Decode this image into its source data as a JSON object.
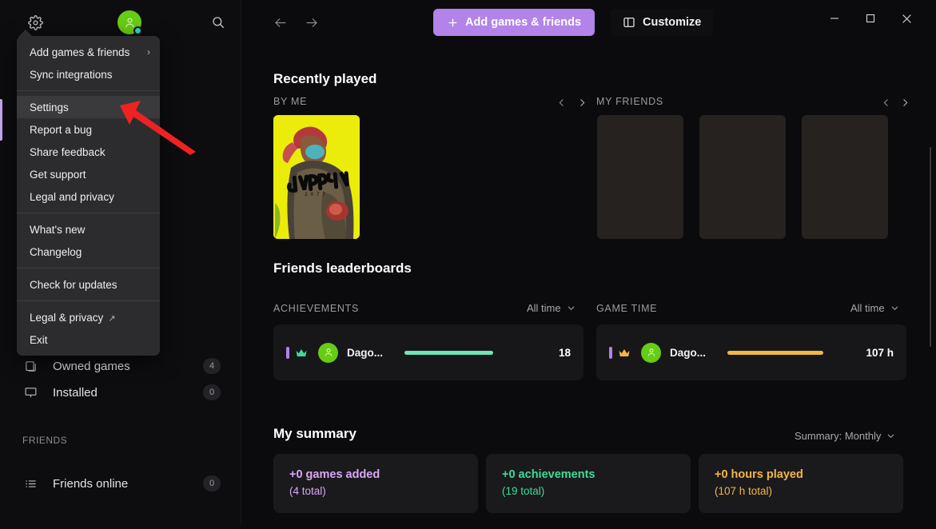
{
  "window": {
    "controls": [
      {
        "name": "minimize",
        "glyph": "─"
      },
      {
        "name": "maximize",
        "glyph": "□"
      },
      {
        "name": "close",
        "glyph": "✕"
      }
    ]
  },
  "topbar": {
    "back_label": "←",
    "forward_label": "→",
    "add_button": "Add games & friends",
    "add_button_icon": "plus-icon",
    "customize_button": "Customize",
    "customize_icon": "layout-panel-icon"
  },
  "sidebar": {
    "gear_icon": "gear-icon",
    "avatar_icon": "user-avatar-icon",
    "search_icon": "search-icon",
    "items": [
      {
        "label": "Owned games",
        "count": "4",
        "icon": "copy-stack-icon"
      },
      {
        "label": "Installed",
        "count": "0",
        "icon": "monitor-icon"
      }
    ],
    "section_friends": "FRIENDS",
    "friends_items": [
      {
        "label": "Friends online",
        "count": "0",
        "icon": "list-icon"
      }
    ]
  },
  "context_menu": {
    "items": [
      {
        "label": "Add games & friends",
        "chevron": "›",
        "active": false,
        "external": false
      },
      {
        "label": "Sync integrations",
        "chevron": "",
        "active": false,
        "external": false
      },
      {
        "separator": true
      },
      {
        "label": "Settings",
        "chevron": "",
        "active": true,
        "external": false
      },
      {
        "label": "Report a bug",
        "chevron": "",
        "active": false,
        "external": false
      },
      {
        "label": "Share feedback",
        "chevron": "",
        "active": false,
        "external": false
      },
      {
        "label": "Get support",
        "chevron": "",
        "active": false,
        "external": false
      },
      {
        "label": "Legal and privacy",
        "chevron": "",
        "active": false,
        "external": false
      },
      {
        "separator": true
      },
      {
        "label": "What's new",
        "chevron": "",
        "active": false,
        "external": false
      },
      {
        "label": "Changelog",
        "chevron": "",
        "active": false,
        "external": false
      },
      {
        "separator": true
      },
      {
        "label": "Check for updates",
        "chevron": "",
        "active": false,
        "external": false
      },
      {
        "separator": true
      },
      {
        "label": "Legal & privacy",
        "chevron": "",
        "active": false,
        "external": true
      },
      {
        "label": "Exit",
        "chevron": "",
        "active": false,
        "external": false
      }
    ]
  },
  "recently_played": {
    "title": "Recently played",
    "by_me_label": "BY ME",
    "my_friends_label": "MY FRIENDS",
    "game": {
      "title": "Cyberpunk",
      "subtitle": "2077"
    },
    "friend_placeholders": 3,
    "prev_glyph": "‹",
    "next_glyph": "›"
  },
  "leaderboards": {
    "title": "Friends leaderboards",
    "achievements": {
      "label": "ACHIEVEMENTS",
      "filter": "All time",
      "rows": [
        {
          "name": "Dago...",
          "value": "18",
          "bar_pct": 72,
          "bar_color": "#6ee7b7",
          "crown_color": "#3ddc97"
        }
      ]
    },
    "game_time": {
      "label": "GAME TIME",
      "filter": "All time",
      "rows": [
        {
          "name": "Dago...",
          "value": "107 h",
          "bar_pct": 78,
          "bar_color": "#f5b642",
          "crown_color": "#f5b642"
        }
      ]
    }
  },
  "my_summary": {
    "title": "My summary",
    "filter": "Summary: Monthly",
    "cards": [
      {
        "main": "+0 games added",
        "sub": "(4 total)",
        "color": "#d8a8f5"
      },
      {
        "main": "+0 achievements",
        "sub": "(19 total)",
        "color": "#3ddc97"
      },
      {
        "main": "+0 hours played",
        "sub": "(107 h total)",
        "color": "#f5b642"
      }
    ]
  },
  "annotation": {
    "arrow_color": "#ee2222",
    "points_to": "Settings"
  },
  "colors": {
    "accent_purple": "#b283e8",
    "green": "#3ddc97",
    "amber": "#f5b642",
    "avatar_green": "#66cc14",
    "status_teal": "#2ddbc8",
    "bg": "#0b0b0d",
    "panel": "#17171a"
  }
}
